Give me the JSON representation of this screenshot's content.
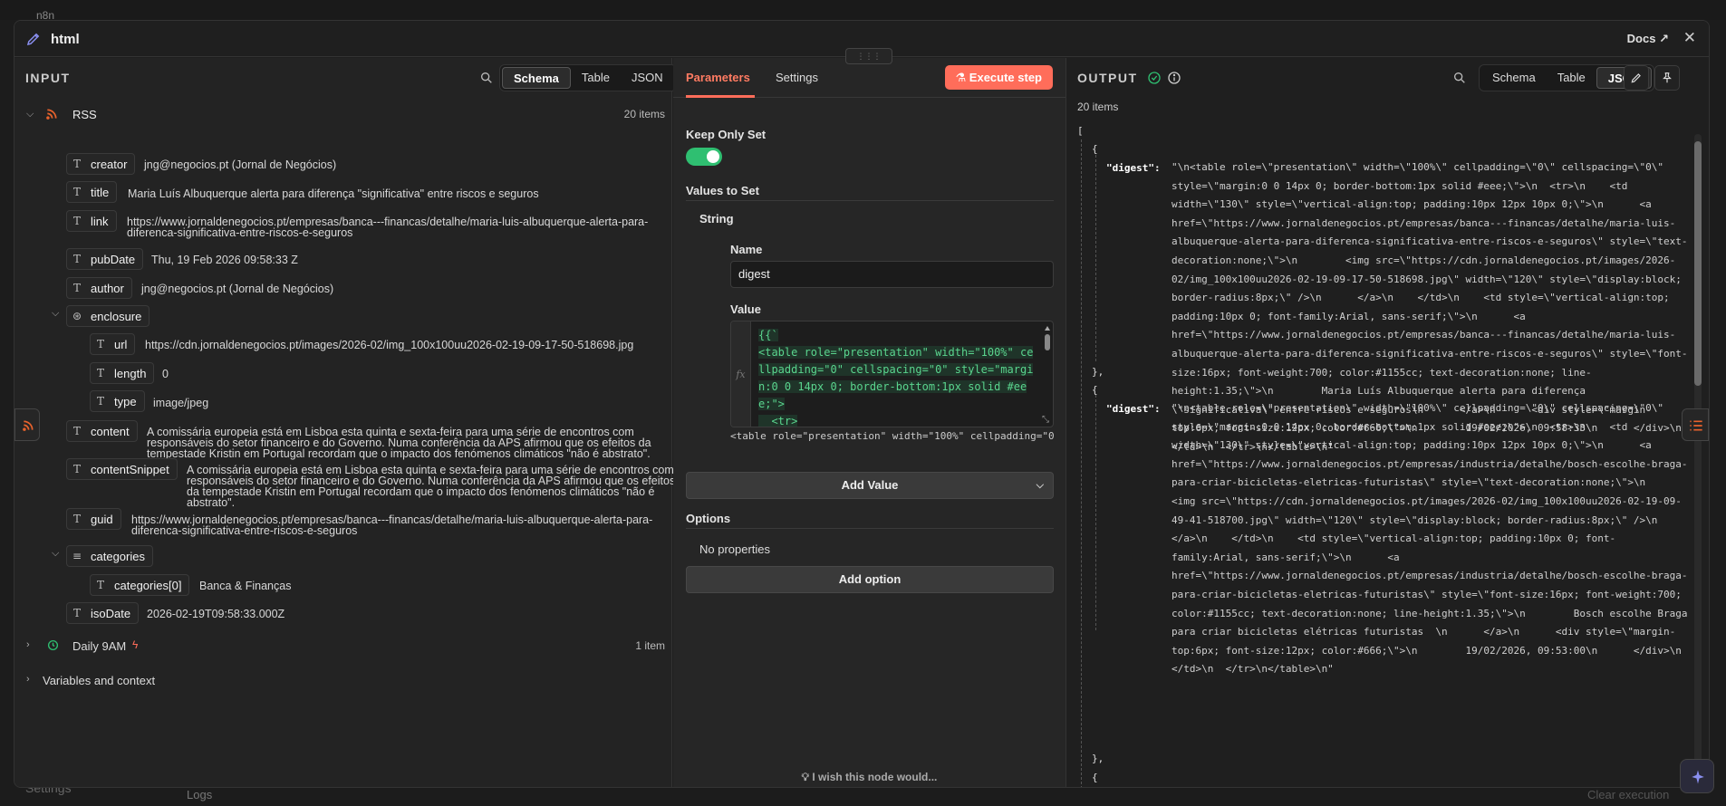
{
  "background": {
    "app_name": "n8n",
    "settings_label": "Settings",
    "logs_label": "Logs",
    "clear_execution_label": "Clear execution"
  },
  "modal": {
    "title": "html",
    "docs_label": "Docs",
    "close_label": "✕"
  },
  "input": {
    "label": "INPUT",
    "view_tabs": [
      "Schema",
      "Table",
      "JSON"
    ],
    "active_view": "Schema",
    "source_node": "RSS",
    "source_count": "20 items",
    "fields": [
      {
        "name": "creator",
        "value": "jng@negocios.pt (Jornal de Negócios)"
      },
      {
        "name": "title",
        "value": "Maria Luís Albuquerque alerta para diferença \"significativa\" entre riscos e seguros"
      },
      {
        "name": "link",
        "value": "https://www.jornaldenegocios.pt/empresas/banca---financas/detalhe/maria-luis-albuquerque-alerta-para-diferenca-significativa-entre-riscos-e-seguros"
      },
      {
        "name": "pubDate",
        "value": "Thu, 19 Feb 2026 09:58:33 Z"
      },
      {
        "name": "author",
        "value": "jng@negocios.pt (Jornal de Negócios)"
      },
      {
        "name": "enclosure",
        "value": ""
      },
      {
        "name": "url",
        "value": "https://cdn.jornaldenegocios.pt/images/2026-02/img_100x100uu2026-02-19-09-17-50-518698.jpg"
      },
      {
        "name": "length",
        "value": "0"
      },
      {
        "name": "type",
        "value": "image/jpeg"
      },
      {
        "name": "content",
        "value": "A comissária europeia está em Lisboa esta quinta e sexta-feira para uma série de encontros com responsáveis do setor financeiro e do Governo. Numa conferência da APS afirmou que os efeitos da tempestade Kristin em Portugal recordam que o impacto dos fenómenos climáticos \"não é abstrato\"."
      },
      {
        "name": "contentSnippet",
        "value": "A comissária europeia está em Lisboa esta quinta e sexta-feira para uma série de encontros com responsáveis do setor financeiro e do Governo. Numa conferência da APS afirmou que os efeitos da tempestade Kristin em Portugal recordam que o impacto dos fenómenos climáticos \"não é abstrato\"."
      },
      {
        "name": "guid",
        "value": "https://www.jornaldenegocios.pt/empresas/banca---financas/detalhe/maria-luis-albuquerque-alerta-para-diferenca-significativa-entre-riscos-e-seguros"
      },
      {
        "name": "categories",
        "value": ""
      },
      {
        "name": "categories[0]",
        "value": "Banca & Finanças"
      },
      {
        "name": "isoDate",
        "value": "2026-02-19T09:58:33.000Z"
      }
    ],
    "other_node": "Daily 9AM",
    "other_node_count": "1 item",
    "variables_label": "Variables and context"
  },
  "parameters": {
    "tab_parameters": "Parameters",
    "tab_settings": "Settings",
    "execute_label": "Execute step",
    "keep_only_set_label": "Keep Only Set",
    "keep_only_set_on": true,
    "values_to_set_label": "Values to Set",
    "string_label": "String",
    "name_label": "Name",
    "name_value": "digest",
    "value_label": "Value",
    "code_lines": [
      "{{`",
      "<table role=\"presentation\" width=\"100%\" cellpadding=\"0\" cellspacing=\"0\" style=\"margin:0 0 14px 0; border-bottom:1px solid #eee;\">",
      "  <tr>"
    ],
    "value_preview": "<table role=\"presentation\" width=\"100%\" cellpadding=\"0\" cellspacing=\"0\"",
    "add_value_label": "Add Value",
    "options_label": "Options",
    "no_properties_label": "No properties",
    "add_option_label": "Add option",
    "wish_label": "I wish this node would..."
  },
  "output": {
    "label": "OUTPUT",
    "view_tabs": [
      "Schema",
      "Table",
      "JSON"
    ],
    "active_view": "JSON",
    "items_count": "20 items",
    "open_bracket": "[",
    "open_brace": "{",
    "close_brace": "},",
    "key": "\"digest\":",
    "digest_1": "\"\\n<table role=\\\"presentation\\\" width=\\\"100%\\\" cellpadding=\\\"0\\\" cellspacing=\\\"0\\\" style=\\\"margin:0 0 14px 0; border-bottom:1px solid #eee;\\\">\\n  <tr>\\n    <td width=\\\"130\\\" style=\\\"vertical-align:top; padding:10px 12px 10px 0;\\\">\\n      <a href=\\\"https://www.jornaldenegocios.pt/empresas/banca---financas/detalhe/maria-luis-albuquerque-alerta-para-diferenca-significativa-entre-riscos-e-seguros\\\" style=\\\"text-decoration:none;\\\">\\n        <img src=\\\"https://cdn.jornaldenegocios.pt/images/2026-02/img_100x100uu2026-02-19-09-17-50-518698.jpg\\\" width=\\\"120\\\" style=\\\"display:block; border-radius:8px;\\\" />\\n      </a>\\n    </td>\\n    <td style=\\\"vertical-align:top; padding:10px 0; font-family:Arial, sans-serif;\\\">\\n      <a href=\\\"https://www.jornaldenegocios.pt/empresas/banca---financas/detalhe/maria-luis-albuquerque-alerta-para-diferenca-significativa-entre-riscos-e-seguros\\\" style=\\\"font-size:16px; font-weight:700; color:#1155cc; text-decoration:none; line-height:1.35;\\\">\\n        Maria Luís Albuquerque alerta para diferença \\\"significativa\\\" entre riscos e seguros\\n      </a>\\n      <div style=\\\"margin-top:6px; font-size:12px; color:#666;\\\">\\n        19/02/2026, 09:58:33\\n      </div>\\n    </td>\\n  </tr>\\n</table>\\n\"",
    "digest_2": "\"\\n<table role=\\\"presentation\\\" width=\\\"100%\\\" cellpadding=\\\"0\\\" cellspacing=\\\"0\\\" style=\\\"margin:0 0 14px 0; border-bottom:1px solid #eee;\\\">\\n  <tr>\\n    <td width=\\\"130\\\" style=\\\"vertical-align:top; padding:10px 12px 10px 0;\\\">\\n      <a href=\\\"https://www.jornaldenegocios.pt/empresas/industria/detalhe/bosch-escolhe-braga-para-criar-bicicletas-eletricas-futuristas\\\" style=\\\"text-decoration:none;\\\">\\n        <img src=\\\"https://cdn.jornaldenegocios.pt/images/2026-02/img_100x100uu2026-02-19-09-49-41-518700.jpg\\\" width=\\\"120\\\" style=\\\"display:block; border-radius:8px;\\\" />\\n      </a>\\n    </td>\\n    <td style=\\\"vertical-align:top; padding:10px 0; font-family:Arial, sans-serif;\\\">\\n      <a href=\\\"https://www.jornaldenegocios.pt/empresas/industria/detalhe/bosch-escolhe-braga-para-criar-bicicletas-eletricas-futuristas\\\" style=\\\"font-size:16px; font-weight:700; color:#1155cc; text-decoration:none; line-height:1.35;\\\">\\n        Bosch escolhe Braga para criar bicicletas elétricas futuristas  \\n      </a>\\n      <div style=\\\"margin-top:6px; font-size:12px; color:#666;\\\">\\n        19/02/2026, 09:53:00\\n      </div>\\n    </td>\\n  </tr>\\n</table>\\n\""
  },
  "colors": {
    "accent": "#ff6d5a",
    "toggle_on": "#2fbf71",
    "success": "#2fbf71",
    "rss_orange": "#e8622c"
  }
}
